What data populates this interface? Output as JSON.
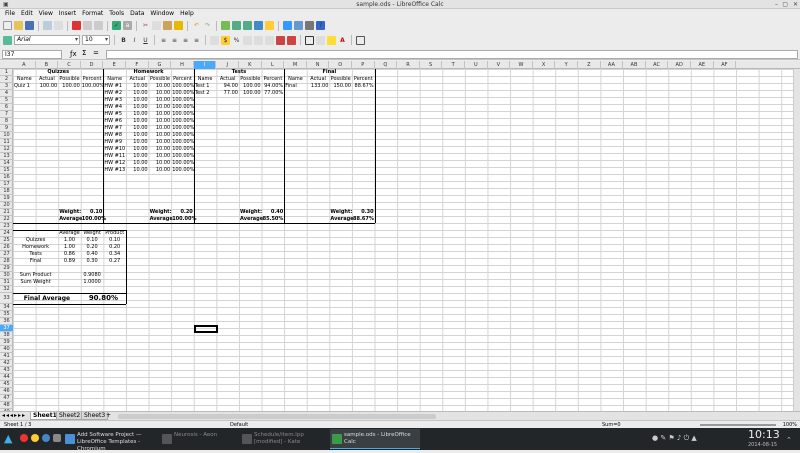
{
  "window": {
    "title": "sample.ods - LibreOffice Calc"
  },
  "menu": [
    "File",
    "Edit",
    "View",
    "Insert",
    "Format",
    "Tools",
    "Data",
    "Window",
    "Help"
  ],
  "toolbar": {
    "font_name": "Arial",
    "font_size": "10"
  },
  "namebox": "I37",
  "columns": [
    "A",
    "B",
    "C",
    "D",
    "E",
    "F",
    "G",
    "H",
    "I",
    "J",
    "K",
    "L",
    "M",
    "N",
    "O",
    "P",
    "Q",
    "R",
    "S",
    "T",
    "U",
    "V",
    "W",
    "X",
    "Y",
    "Z",
    "AA",
    "AB",
    "AC",
    "AD",
    "AE",
    "AF"
  ],
  "selected_col": "I",
  "selected_row": "37",
  "sections": {
    "quizzes": "Quizzes",
    "homework": "Homework",
    "tests": "Tests",
    "final": "Final"
  },
  "headers": {
    "name": "Name",
    "actual": "Actual",
    "possible": "Possible",
    "percent": "Percent"
  },
  "quizzes": [
    {
      "name": "Quiz 1",
      "actual": "100.00",
      "possible": "100.00",
      "percent": "100.00%"
    }
  ],
  "homework": [
    {
      "name": "HW #1",
      "actual": "10.00",
      "possible": "10.00",
      "percent": "100.00%"
    },
    {
      "name": "HW #2",
      "actual": "10.00",
      "possible": "10.00",
      "percent": "100.00%"
    },
    {
      "name": "HW #3",
      "actual": "10.00",
      "possible": "10.00",
      "percent": "100.00%"
    },
    {
      "name": "HW #4",
      "actual": "10.00",
      "possible": "10.00",
      "percent": "100.00%"
    },
    {
      "name": "HW #5",
      "actual": "10.00",
      "possible": "10.00",
      "percent": "100.00%"
    },
    {
      "name": "HW #6",
      "actual": "10.00",
      "possible": "10.00",
      "percent": "100.00%"
    },
    {
      "name": "HW #7",
      "actual": "10.00",
      "possible": "10.00",
      "percent": "100.00%"
    },
    {
      "name": "HW #8",
      "actual": "10.00",
      "possible": "10.00",
      "percent": "100.00%"
    },
    {
      "name": "HW #9",
      "actual": "10.00",
      "possible": "10.00",
      "percent": "100.00%"
    },
    {
      "name": "HW #10",
      "actual": "10.00",
      "possible": "10.00",
      "percent": "100.00%"
    },
    {
      "name": "HW #11",
      "actual": "10.00",
      "possible": "10.00",
      "percent": "100.00%"
    },
    {
      "name": "HW #12",
      "actual": "10.00",
      "possible": "10.00",
      "percent": "100.00%"
    },
    {
      "name": "HW #13",
      "actual": "10.00",
      "possible": "10.00",
      "percent": "100.00%"
    }
  ],
  "tests": [
    {
      "name": "Test 1",
      "actual": "94.00",
      "possible": "100.00",
      "percent": "94.00%"
    },
    {
      "name": "Test 2",
      "actual": "77.00",
      "possible": "100.00",
      "percent": "77.00%"
    }
  ],
  "final": [
    {
      "name": "Final",
      "actual": "133.00",
      "possible": "150.00",
      "percent": "88.67%"
    }
  ],
  "weights": {
    "label_weight": "Weight:",
    "label_average": "Average",
    "quizzes": {
      "weight": "0.10",
      "average": "100.00%"
    },
    "homework": {
      "weight": "0.20",
      "average": "100.00%"
    },
    "tests": {
      "weight": "0.40",
      "average": "85.50%"
    },
    "final": {
      "weight": "0.30",
      "average": "88.67%"
    }
  },
  "summary": {
    "headers": {
      "average": "Average",
      "weight": "Weight",
      "product": "Product"
    },
    "rows": [
      {
        "label": "Quizzes",
        "average": "1.00",
        "weight": "0.10",
        "product": "0.10"
      },
      {
        "label": "Homework",
        "average": "1.00",
        "weight": "0.20",
        "product": "0.20"
      },
      {
        "label": "Tests",
        "average": "0.86",
        "weight": "0.40",
        "product": "0.34"
      },
      {
        "label": "Final",
        "average": "0.89",
        "weight": "0.30",
        "product": "0.27"
      }
    ],
    "sum_product_label": "Sum Product",
    "sum_product": "0.9080",
    "sum_weight_label": "Sum Weight",
    "sum_weight": "1.0000",
    "final_average_label": "Final Average",
    "final_average": "90.80%"
  },
  "tabs": [
    "Sheet1",
    "Sheet2",
    "Sheet3"
  ],
  "status": {
    "sheet": "Sheet 1 / 3",
    "style": "Default",
    "sum": "Sum=0",
    "zoom": "100%"
  },
  "taskbar": {
    "items": [
      {
        "label": "Add Software Project — LibreOffice Templates - Chromium"
      },
      {
        "label": "Neurosis - Aeon"
      },
      {
        "label": "Schedule/item.lpp [modified] - Kate"
      },
      {
        "label": "sample.ods - LibreOffice Calc"
      }
    ],
    "time": "10:13",
    "date": "2014-08-15"
  }
}
